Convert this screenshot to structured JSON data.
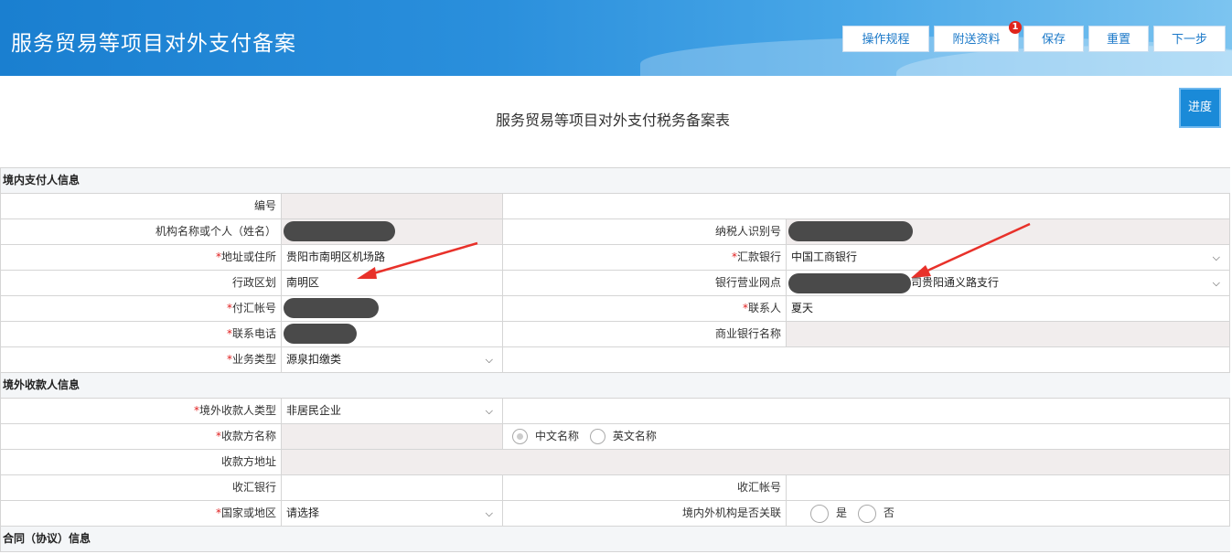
{
  "header": {
    "title": "服务贸易等项目对外支付备案",
    "buttons": {
      "rules": "操作规程",
      "attach": "附送资料",
      "save": "保存",
      "reset": "重置",
      "next": "下一步"
    },
    "attach_badge": "1"
  },
  "form": {
    "title": "服务贸易等项目对外支付税务备案表",
    "progress": "进度"
  },
  "sections": {
    "payer": "境内支付人信息",
    "payee": "境外收款人信息",
    "contract": "合同（协议）信息"
  },
  "payer": {
    "number_label": "编号",
    "name_label": "机构名称或个人（姓名）",
    "taxid_label": "纳税人识别号",
    "address_label": "地址或住所",
    "address_value": "贵阳市南明区机场路",
    "bank_label": "汇款银行",
    "bank_value": "中国工商银行",
    "district_label": "行政区划",
    "district_value": "南明区",
    "branch_label": "银行营业网点",
    "branch_value_suffix": "司贵阳通义路支行",
    "account_label": "付汇帐号",
    "contact_label": "联系人",
    "contact_value": "夏天",
    "phone_label": "联系电话",
    "commercial_bank_label": "商业银行名称",
    "biz_type_label": "业务类型",
    "biz_type_value": "源泉扣缴类"
  },
  "payee": {
    "type_label": "境外收款人类型",
    "type_value": "非居民企业",
    "name_label": "收款方名称",
    "name_opt_cn": "中文名称",
    "name_opt_en": "英文名称",
    "address_label": "收款方地址",
    "bank_label": "收汇银行",
    "account_label": "收汇帐号",
    "country_label": "国家或地区",
    "country_value": "请选择",
    "related_label": "境内外机构是否关联",
    "related_yes": "是",
    "related_no": "否"
  },
  "required_mark": "*",
  "colors": {
    "header": "#1a7fd0",
    "accent": "#1a8ad8",
    "required": "#e02020",
    "badge": "#e0241b",
    "readonly_bg": "#f1eded"
  }
}
